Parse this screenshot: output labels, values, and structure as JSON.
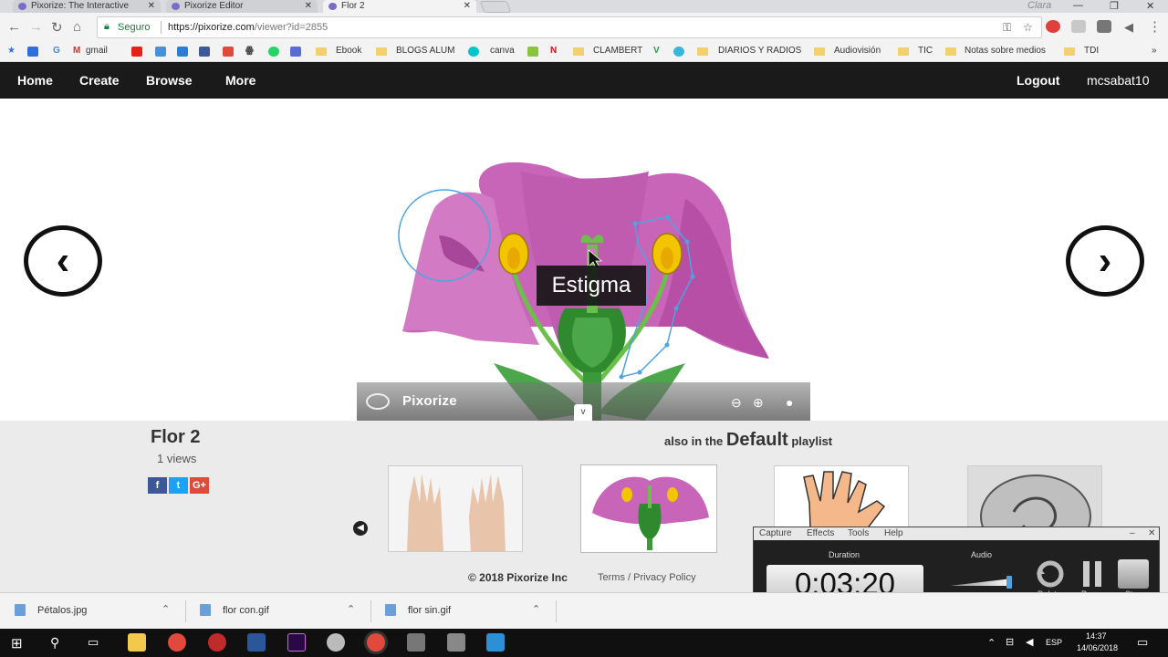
{
  "browser": {
    "tabs": [
      {
        "label": "Pixorize: The Interactive",
        "active": false
      },
      {
        "label": "Pixorize Editor",
        "active": false
      },
      {
        "label": "Flor 2",
        "active": true
      }
    ],
    "user_chip": "Clara",
    "address": {
      "security": "Seguro",
      "url_host": "https://pixorize.com",
      "url_path": "/viewer?id=2855"
    },
    "bookmarks": [
      "gmail",
      "Ebook",
      "BLOGS ALUM",
      "canva",
      "CLAMBERT",
      "DIARIOS Y RADIOS",
      "Audiovisión",
      "TIC",
      "Notas sobre medios",
      "TDI"
    ]
  },
  "site_nav": {
    "left": [
      "Home",
      "Create",
      "Browse",
      "More"
    ],
    "logout": "Logout",
    "username": "mcsabat10"
  },
  "viewer": {
    "tooltip": "Estigma",
    "brand": "Pixorize",
    "toggle": "v",
    "prev_glyph": "‹",
    "next_glyph": "›"
  },
  "info": {
    "title": "Flor 2",
    "views": "1 views",
    "social": [
      "f",
      "t",
      "G+"
    ],
    "also_prefix": "also in the",
    "playlist": "Default",
    "also_suffix": "playlist",
    "thumbnails": [
      "hands",
      "flower",
      "palm-hand",
      "sketch"
    ],
    "footer": "© 2018 Pixorize Inc",
    "footer_links": "Terms / Privacy Policy"
  },
  "recorder": {
    "menu": [
      "Capture",
      "Effects",
      "Tools",
      "Help"
    ],
    "duration_label": "Duration",
    "duration": "0:03:20",
    "audio_label": "Audio",
    "audio_level": 0.95,
    "buttons": [
      "Delete",
      "Pause",
      "Stop"
    ]
  },
  "downloads": [
    {
      "name": "Pétalos.jpg"
    },
    {
      "name": "flor con.gif"
    },
    {
      "name": "flor sin.gif"
    }
  ],
  "taskbar": {
    "lang": "ESP",
    "time": "14:37",
    "date": "14/06/2018"
  },
  "colors": {
    "petal": "#c865b8",
    "stem": "#2f8a2f",
    "anther": "#f2c500",
    "nav_bg": "#1a1a1a"
  }
}
